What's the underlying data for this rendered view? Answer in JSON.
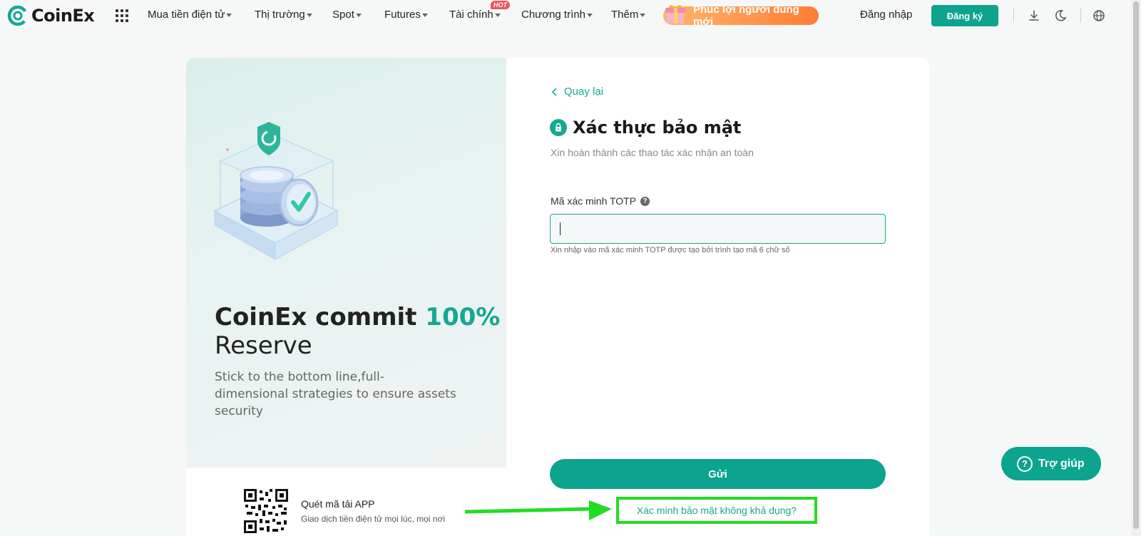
{
  "header": {
    "brand": "CoinEx",
    "nav": [
      {
        "label": "Mua tiền điện tử"
      },
      {
        "label": "Thị trường"
      },
      {
        "label": "Spot"
      },
      {
        "label": "Futures"
      },
      {
        "label": "Tài chính",
        "badge": "HOT"
      },
      {
        "label": "Chương trình"
      },
      {
        "label": "Thêm"
      }
    ],
    "promo_label": "Phúc lợi người dùng mới",
    "login_label": "Đăng nhập",
    "signup_label": "Đăng ký"
  },
  "hero": {
    "headline_part1": "CoinEx commit ",
    "headline_accent": "100%",
    "headline_part2": "Reserve",
    "subline": "Stick to the bottom line,full-dimensional strategies to ensure assets security"
  },
  "app_download": {
    "title": "Quét mã tải APP",
    "subtitle": "Giao dịch tiền điện tử mọi lúc, mọi nơi"
  },
  "form": {
    "back_label": "Quay lại",
    "title": "Xác thực bảo mật",
    "subtitle": "Xin hoàn thành các thao tác xác nhận an toàn",
    "field_label": "Mã xác minh TOTP",
    "field_value": "",
    "field_hint": "Xin nhập vào mã xác minh TOTP được tạo bởi trình tạo mã 6 chữ số",
    "submit_label": "Gửi",
    "alt_link": "Xác minh bảo mật không khả dụng?"
  },
  "help_button": "Trợ giúp",
  "colors": {
    "brand": "#0ca38f",
    "accent_text": "#14a892",
    "annotation": "#22dd22",
    "hot_badge": "#f0525f"
  },
  "icons": [
    "apps-grid-icon",
    "gift-icon",
    "download-icon",
    "moon-icon",
    "globe-icon",
    "chevron-left-icon",
    "lock-icon",
    "help-circle-icon"
  ]
}
